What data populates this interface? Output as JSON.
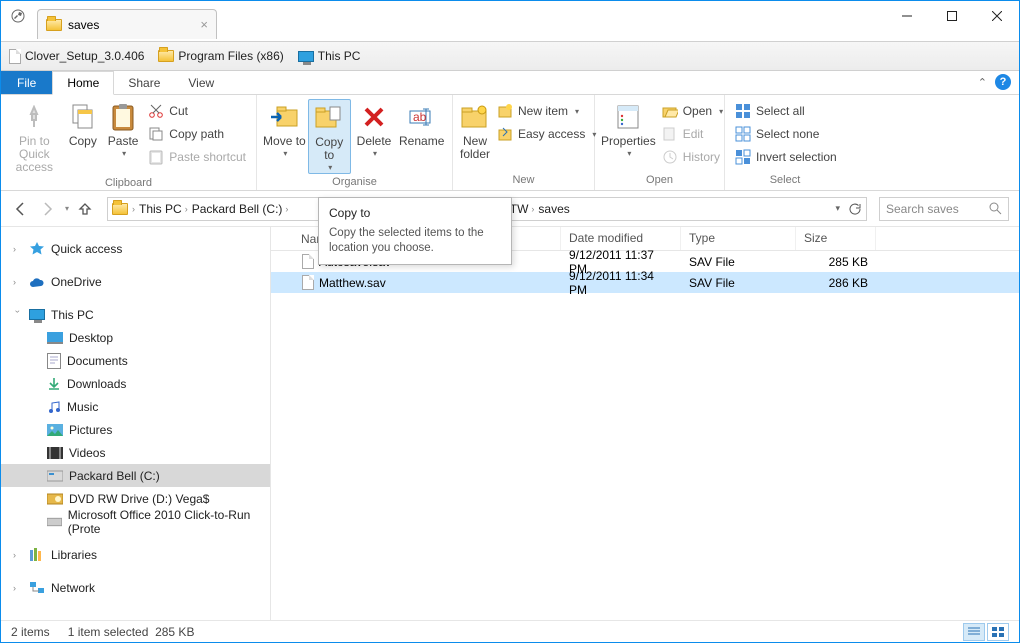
{
  "window": {
    "tab_title": "saves",
    "bookmarks": [
      {
        "label": "Clover_Setup_3.0.406",
        "icon": "file"
      },
      {
        "label": "Program Files (x86)",
        "icon": "folder"
      },
      {
        "label": "This PC",
        "icon": "monitor"
      }
    ]
  },
  "ribbon": {
    "file": "File",
    "tabs": {
      "home": "Home",
      "share": "Share",
      "view": "View"
    },
    "clipboard": {
      "pin": "Pin to Quick access",
      "copy": "Copy",
      "paste": "Paste",
      "cut": "Cut",
      "copy_path": "Copy path",
      "paste_shortcut": "Paste shortcut",
      "label": "Clipboard"
    },
    "organise": {
      "move_to": "Move to",
      "copy_to": "Copy to",
      "delete": "Delete",
      "rename": "Rename",
      "label": "Organise"
    },
    "new": {
      "new_folder": "New folder",
      "new_item": "New item",
      "easy_access": "Easy access",
      "label": "New"
    },
    "open": {
      "properties": "Properties",
      "open": "Open",
      "edit": "Edit",
      "history": "History",
      "label": "Open"
    },
    "select": {
      "select_all": "Select all",
      "select_none": "Select none",
      "invert": "Invert selection",
      "label": "Select"
    }
  },
  "tooltip": {
    "title": "Copy to",
    "body": "Copy the selected items to the location you choose."
  },
  "address": {
    "crumbs": [
      "This PC",
      "Packard Bell (C:)",
      "neTW",
      "saves"
    ],
    "partial_hidden": true
  },
  "search": {
    "placeholder": "Search saves"
  },
  "sidebar": {
    "quick_access": "Quick access",
    "onedrive": "OneDrive",
    "this_pc": "This PC",
    "children": [
      "Desktop",
      "Documents",
      "Downloads",
      "Music",
      "Pictures",
      "Videos",
      "Packard Bell (C:)",
      "DVD RW Drive (D:) Vega$",
      "Microsoft Office 2010 Click-to-Run (Prote"
    ],
    "libraries": "Libraries",
    "network": "Network"
  },
  "list": {
    "columns": {
      "name": "Name",
      "date": "Date modified",
      "type": "Type",
      "size": "Size"
    },
    "rows": [
      {
        "name": "Autosave.sav",
        "date": "9/12/2011 11:37 PM",
        "type": "SAV File",
        "size": "285 KB",
        "selected": false
      },
      {
        "name": "Matthew.sav",
        "date": "9/12/2011 11:34 PM",
        "type": "SAV File",
        "size": "286 KB",
        "selected": true
      }
    ]
  },
  "status": {
    "items": "2 items",
    "selection": "1 item selected",
    "size": "285 KB"
  }
}
